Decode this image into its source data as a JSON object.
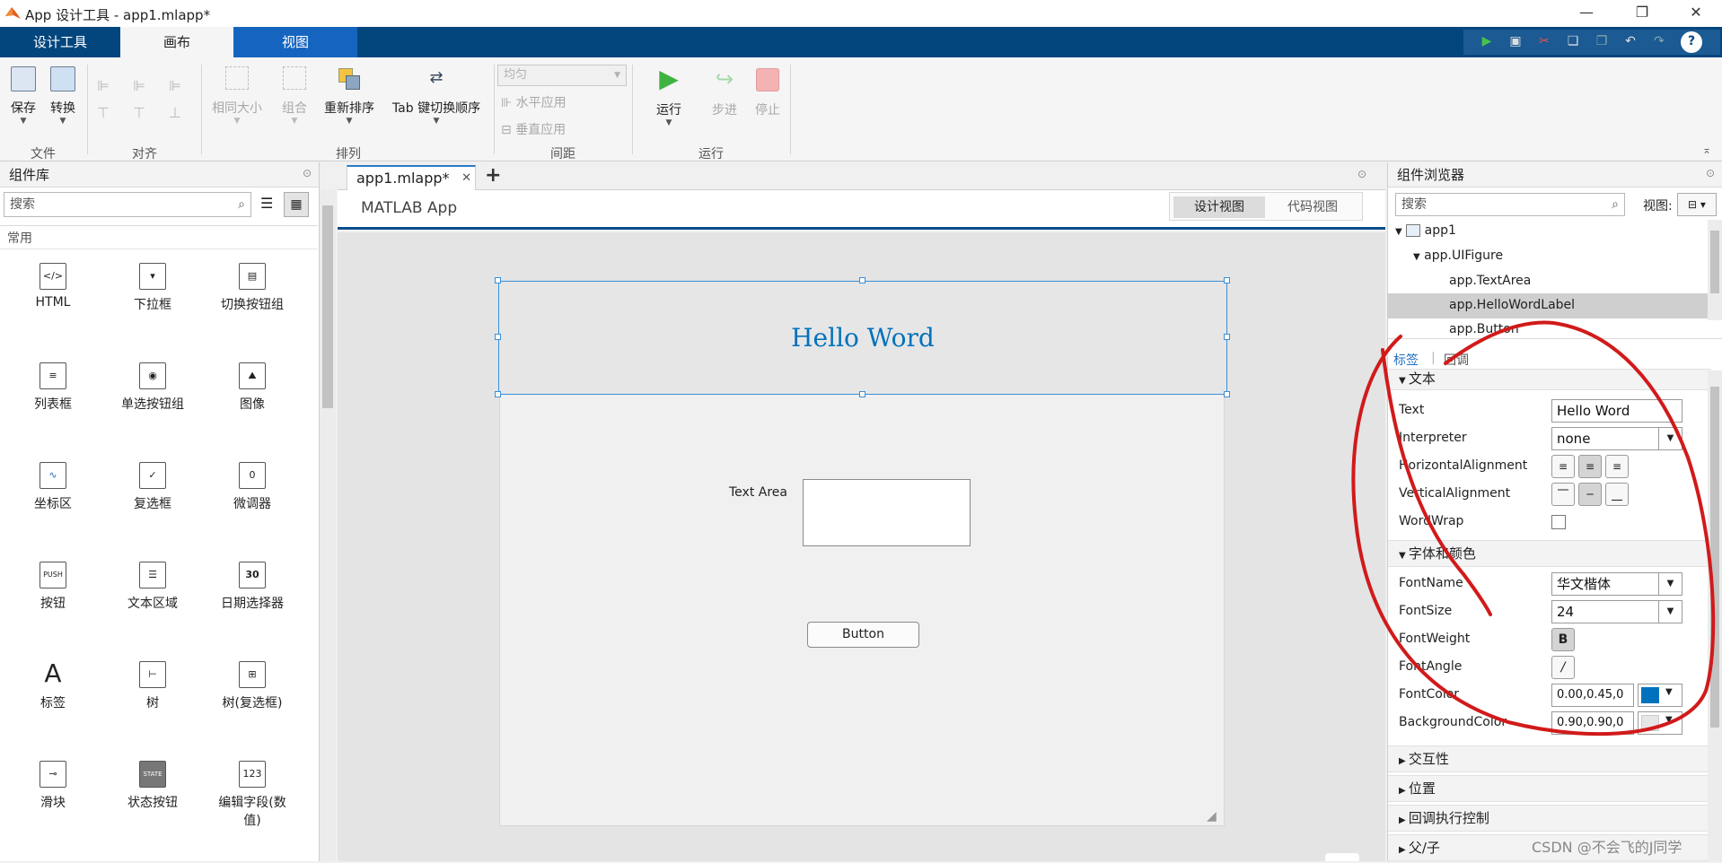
{
  "window": {
    "title": "App 设计工具 - app1.mlapp*"
  },
  "ribbon_tabs": [
    "设计工具",
    "画布",
    "视图"
  ],
  "ribbon": {
    "groups": {
      "file": "文件",
      "align": "对齐",
      "arrange": "排列",
      "spacing": "间距",
      "run": "运行"
    },
    "buttons": {
      "save": "保存",
      "convert": "转换",
      "same_size": "相同大小",
      "group": "组合",
      "reorder": "重新排序",
      "tab_order": "Tab 键切换顺序",
      "spacing_value": "均匀",
      "horizontal_apply": "水平应用",
      "vertical_apply": "垂直应用",
      "run": "运行",
      "step": "步进",
      "stop": "停止"
    }
  },
  "component_library": {
    "header": "组件库",
    "search_placeholder": "搜索",
    "section": "常用",
    "items": [
      "HTML",
      "下拉框",
      "切换按钮组",
      "列表框",
      "单选按钮组",
      "图像",
      "坐标区",
      "复选框",
      "微调器",
      "按钮",
      "文本区域",
      "日期选择器",
      "标签",
      "树",
      "树(复选框)",
      "滑块",
      "状态按钮",
      "编辑字段(数\n值)"
    ],
    "icon_text": {
      "html": "</>",
      "push": "PUSH",
      "date": "30",
      "spinner": "0",
      "state": "STATE",
      "num": "123",
      "label": "A"
    }
  },
  "document": {
    "tab": "app1.mlapp*",
    "app_title": "MATLAB App",
    "view_design": "设计视图",
    "view_code": "代码视图"
  },
  "canvas": {
    "label_text": "Hello Word",
    "label_color": "#0072bd",
    "textarea_label": "Text Area",
    "button_text": "Button"
  },
  "component_browser": {
    "header": "组件浏览器",
    "search_placeholder": "搜索",
    "view_label": "视图:",
    "tree": [
      "app1",
      "app.UIFigure",
      "app.TextArea",
      "app.HelloWordLabel",
      "app.Button"
    ],
    "tabs": {
      "labels": "标签",
      "callbacks": "回调"
    },
    "sections": {
      "text": "文本",
      "font_color": "字体和颜色",
      "interactivity": "交互性",
      "position": "位置",
      "callback_control": "回调执行控制",
      "parent_child": "父/子"
    },
    "props": {
      "Text": {
        "name": "Text",
        "value": "Hello Word"
      },
      "Interpreter": {
        "name": "Interpreter",
        "value": "none"
      },
      "HorizontalAlignment": {
        "name": "HorizontalAlignment"
      },
      "VerticalAlignment": {
        "name": "VerticalAlignment"
      },
      "WordWrap": {
        "name": "WordWrap"
      },
      "FontName": {
        "name": "FontName",
        "value": "华文楷体"
      },
      "FontSize": {
        "name": "FontSize",
        "value": "24"
      },
      "FontWeight": {
        "name": "FontWeight",
        "button": "B"
      },
      "FontAngle": {
        "name": "FontAngle",
        "button": "/"
      },
      "FontColor": {
        "name": "FontColor",
        "value": "0.00,0.45,0",
        "swatch": "#0072bd"
      },
      "BackgroundColor": {
        "name": "BackgroundColor",
        "value": "0.90,0.90,0",
        "swatch": "#e6e6e6"
      }
    }
  },
  "watermark": "CSDN @不会飞的J同学",
  "colors": {
    "ribbon_dark": "#03467e",
    "annotation": "#d11a1a"
  }
}
